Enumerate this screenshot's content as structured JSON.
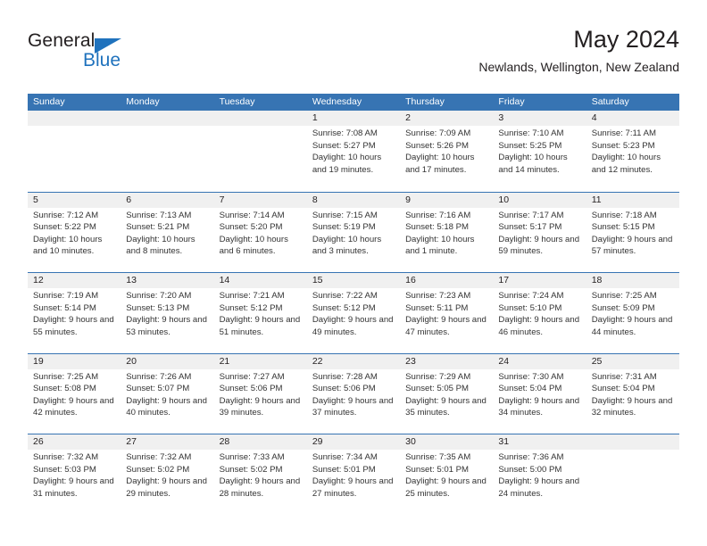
{
  "brand": {
    "name_top": "General",
    "name_bottom": "Blue",
    "triangle_color": "#1f72bd"
  },
  "header": {
    "title": "May 2024",
    "subtitle": "Newlands, Wellington, New Zealand"
  },
  "theme": {
    "header_blue": "#3774b3",
    "daynum_band": "#f0f0f0",
    "text": "#231f20"
  },
  "weekdays": [
    "Sunday",
    "Monday",
    "Tuesday",
    "Wednesday",
    "Thursday",
    "Friday",
    "Saturday"
  ],
  "weeks": [
    [
      {
        "day": "",
        "sunrise": "",
        "sunset": "",
        "daylight": "",
        "empty": true
      },
      {
        "day": "",
        "sunrise": "",
        "sunset": "",
        "daylight": "",
        "empty": true
      },
      {
        "day": "",
        "sunrise": "",
        "sunset": "",
        "daylight": "",
        "empty": true
      },
      {
        "day": "1",
        "sunrise": "Sunrise: 7:08 AM",
        "sunset": "Sunset: 5:27 PM",
        "daylight": "Daylight: 10 hours and 19 minutes."
      },
      {
        "day": "2",
        "sunrise": "Sunrise: 7:09 AM",
        "sunset": "Sunset: 5:26 PM",
        "daylight": "Daylight: 10 hours and 17 minutes."
      },
      {
        "day": "3",
        "sunrise": "Sunrise: 7:10 AM",
        "sunset": "Sunset: 5:25 PM",
        "daylight": "Daylight: 10 hours and 14 minutes."
      },
      {
        "day": "4",
        "sunrise": "Sunrise: 7:11 AM",
        "sunset": "Sunset: 5:23 PM",
        "daylight": "Daylight: 10 hours and 12 minutes."
      }
    ],
    [
      {
        "day": "5",
        "sunrise": "Sunrise: 7:12 AM",
        "sunset": "Sunset: 5:22 PM",
        "daylight": "Daylight: 10 hours and 10 minutes."
      },
      {
        "day": "6",
        "sunrise": "Sunrise: 7:13 AM",
        "sunset": "Sunset: 5:21 PM",
        "daylight": "Daylight: 10 hours and 8 minutes."
      },
      {
        "day": "7",
        "sunrise": "Sunrise: 7:14 AM",
        "sunset": "Sunset: 5:20 PM",
        "daylight": "Daylight: 10 hours and 6 minutes."
      },
      {
        "day": "8",
        "sunrise": "Sunrise: 7:15 AM",
        "sunset": "Sunset: 5:19 PM",
        "daylight": "Daylight: 10 hours and 3 minutes."
      },
      {
        "day": "9",
        "sunrise": "Sunrise: 7:16 AM",
        "sunset": "Sunset: 5:18 PM",
        "daylight": "Daylight: 10 hours and 1 minute."
      },
      {
        "day": "10",
        "sunrise": "Sunrise: 7:17 AM",
        "sunset": "Sunset: 5:17 PM",
        "daylight": "Daylight: 9 hours and 59 minutes."
      },
      {
        "day": "11",
        "sunrise": "Sunrise: 7:18 AM",
        "sunset": "Sunset: 5:15 PM",
        "daylight": "Daylight: 9 hours and 57 minutes."
      }
    ],
    [
      {
        "day": "12",
        "sunrise": "Sunrise: 7:19 AM",
        "sunset": "Sunset: 5:14 PM",
        "daylight": "Daylight: 9 hours and 55 minutes."
      },
      {
        "day": "13",
        "sunrise": "Sunrise: 7:20 AM",
        "sunset": "Sunset: 5:13 PM",
        "daylight": "Daylight: 9 hours and 53 minutes."
      },
      {
        "day": "14",
        "sunrise": "Sunrise: 7:21 AM",
        "sunset": "Sunset: 5:12 PM",
        "daylight": "Daylight: 9 hours and 51 minutes."
      },
      {
        "day": "15",
        "sunrise": "Sunrise: 7:22 AM",
        "sunset": "Sunset: 5:12 PM",
        "daylight": "Daylight: 9 hours and 49 minutes."
      },
      {
        "day": "16",
        "sunrise": "Sunrise: 7:23 AM",
        "sunset": "Sunset: 5:11 PM",
        "daylight": "Daylight: 9 hours and 47 minutes."
      },
      {
        "day": "17",
        "sunrise": "Sunrise: 7:24 AM",
        "sunset": "Sunset: 5:10 PM",
        "daylight": "Daylight: 9 hours and 46 minutes."
      },
      {
        "day": "18",
        "sunrise": "Sunrise: 7:25 AM",
        "sunset": "Sunset: 5:09 PM",
        "daylight": "Daylight: 9 hours and 44 minutes."
      }
    ],
    [
      {
        "day": "19",
        "sunrise": "Sunrise: 7:25 AM",
        "sunset": "Sunset: 5:08 PM",
        "daylight": "Daylight: 9 hours and 42 minutes."
      },
      {
        "day": "20",
        "sunrise": "Sunrise: 7:26 AM",
        "sunset": "Sunset: 5:07 PM",
        "daylight": "Daylight: 9 hours and 40 minutes."
      },
      {
        "day": "21",
        "sunrise": "Sunrise: 7:27 AM",
        "sunset": "Sunset: 5:06 PM",
        "daylight": "Daylight: 9 hours and 39 minutes."
      },
      {
        "day": "22",
        "sunrise": "Sunrise: 7:28 AM",
        "sunset": "Sunset: 5:06 PM",
        "daylight": "Daylight: 9 hours and 37 minutes."
      },
      {
        "day": "23",
        "sunrise": "Sunrise: 7:29 AM",
        "sunset": "Sunset: 5:05 PM",
        "daylight": "Daylight: 9 hours and 35 minutes."
      },
      {
        "day": "24",
        "sunrise": "Sunrise: 7:30 AM",
        "sunset": "Sunset: 5:04 PM",
        "daylight": "Daylight: 9 hours and 34 minutes."
      },
      {
        "day": "25",
        "sunrise": "Sunrise: 7:31 AM",
        "sunset": "Sunset: 5:04 PM",
        "daylight": "Daylight: 9 hours and 32 minutes."
      }
    ],
    [
      {
        "day": "26",
        "sunrise": "Sunrise: 7:32 AM",
        "sunset": "Sunset: 5:03 PM",
        "daylight": "Daylight: 9 hours and 31 minutes."
      },
      {
        "day": "27",
        "sunrise": "Sunrise: 7:32 AM",
        "sunset": "Sunset: 5:02 PM",
        "daylight": "Daylight: 9 hours and 29 minutes."
      },
      {
        "day": "28",
        "sunrise": "Sunrise: 7:33 AM",
        "sunset": "Sunset: 5:02 PM",
        "daylight": "Daylight: 9 hours and 28 minutes."
      },
      {
        "day": "29",
        "sunrise": "Sunrise: 7:34 AM",
        "sunset": "Sunset: 5:01 PM",
        "daylight": "Daylight: 9 hours and 27 minutes."
      },
      {
        "day": "30",
        "sunrise": "Sunrise: 7:35 AM",
        "sunset": "Sunset: 5:01 PM",
        "daylight": "Daylight: 9 hours and 25 minutes."
      },
      {
        "day": "31",
        "sunrise": "Sunrise: 7:36 AM",
        "sunset": "Sunset: 5:00 PM",
        "daylight": "Daylight: 9 hours and 24 minutes."
      },
      {
        "day": "",
        "sunrise": "",
        "sunset": "",
        "daylight": "",
        "empty": true
      }
    ]
  ]
}
